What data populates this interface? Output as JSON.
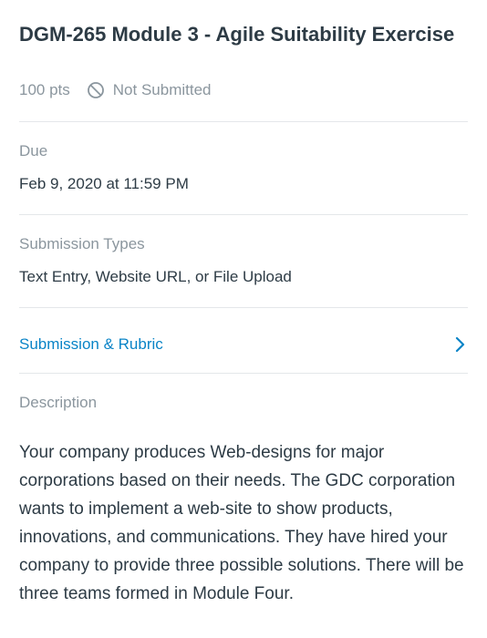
{
  "assignment": {
    "title": "DGM-265 Module 3 - Agile Suitability Exercise",
    "points": "100 pts",
    "status": "Not Submitted"
  },
  "due": {
    "label": "Due",
    "value": "Feb 9, 2020 at 11:59 PM"
  },
  "submission_types": {
    "label": "Submission Types",
    "value": "Text Entry, Website URL, or File Upload"
  },
  "submission_rubric": {
    "label": "Submission & Rubric"
  },
  "description": {
    "label": "Description",
    "text": "Your company produces Web-designs for major corporations based on their needs. The GDC corporation wants to implement a web-site to show products, innovations, and communications. They have hired your company to provide three possible solutions. There will be three teams formed in Module Four."
  },
  "colors": {
    "text": "#2d3b45",
    "muted": "#8b969e",
    "link": "#0a84c7",
    "divider": "#e4e7ea"
  },
  "icons": {
    "status": "not-submitted-icon",
    "chevron": "chevron-right-icon"
  }
}
